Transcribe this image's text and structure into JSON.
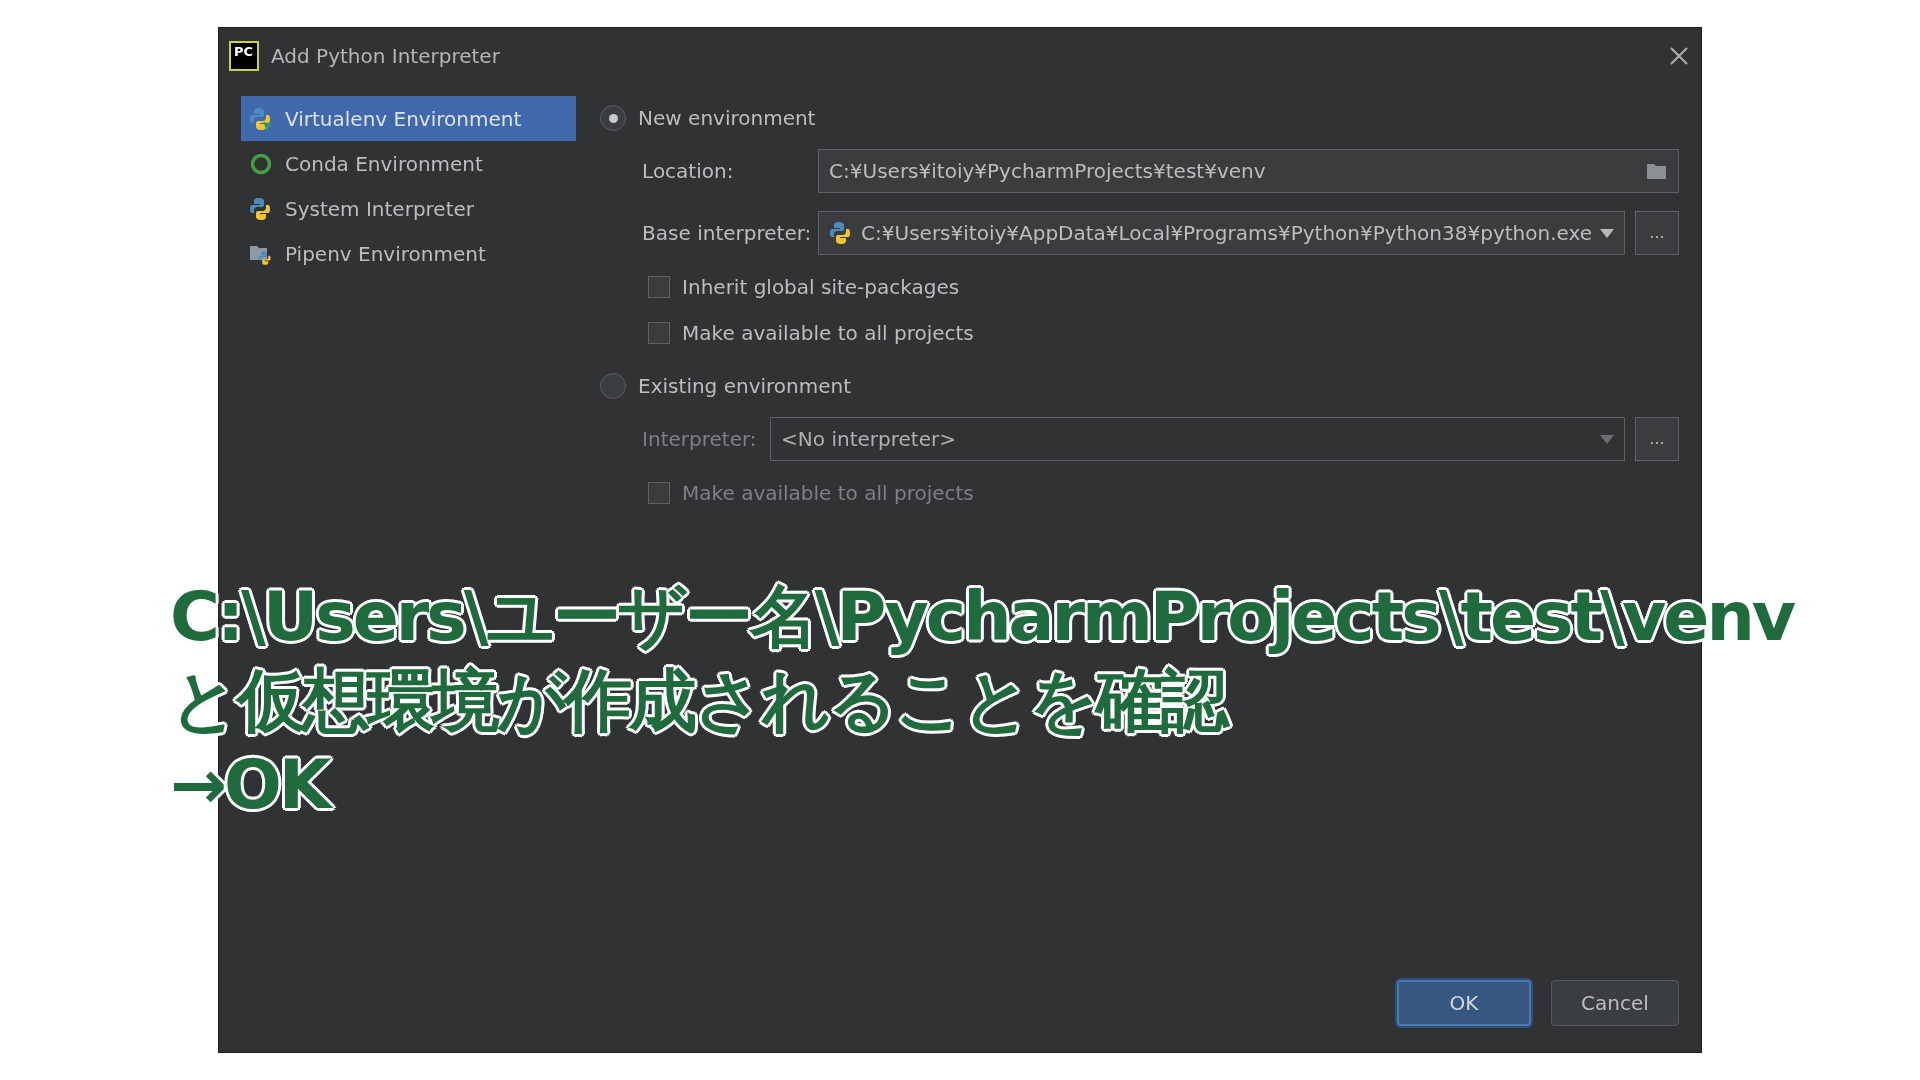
{
  "window": {
    "logo": "PC",
    "title": "Add Python Interpreter"
  },
  "sidebar": {
    "items": [
      {
        "label": "Virtualenv Environment",
        "kind": "virtualenv",
        "selected": true
      },
      {
        "label": "Conda Environment",
        "kind": "conda",
        "selected": false
      },
      {
        "label": "System Interpreter",
        "kind": "python",
        "selected": false
      },
      {
        "label": "Pipenv Environment",
        "kind": "pipenv",
        "selected": false
      }
    ]
  },
  "options": [
    {
      "label": "New environment",
      "selected": true,
      "fields": [
        {
          "label": "Location:",
          "value": "C:¥Users¥itoiy¥PycharmProjects¥test¥venv",
          "kind": "folder"
        },
        {
          "label": "Base interpreter:",
          "value": "C:¥Users¥itoiy¥AppData¥Local¥Programs¥Python¥Python38¥python.exe",
          "kind": "interpreter",
          "browse": "..."
        }
      ],
      "checkboxes": [
        {
          "label": "Inherit global site-packages",
          "checked": false
        },
        {
          "label": "Make available to all projects",
          "checked": false
        }
      ]
    },
    {
      "label": "Existing environment",
      "selected": false,
      "fields": [
        {
          "label": "Interpreter:",
          "value": "<No interpreter>",
          "kind": "dropdown",
          "browse": "..."
        }
      ],
      "checkboxes": [
        {
          "label": "Make available to all projects",
          "checked": false
        }
      ]
    }
  ],
  "caption": {
    "lines": [
      "C:\\Users\\ユーザー名\\PycharmProjects\\test\\venv",
      "と仮想環境が作成されることを確認",
      "→OK"
    ]
  },
  "buttons": [
    {
      "label": "OK",
      "kind": "primary"
    },
    {
      "label": "Cancel",
      "kind": "secondary"
    }
  ]
}
